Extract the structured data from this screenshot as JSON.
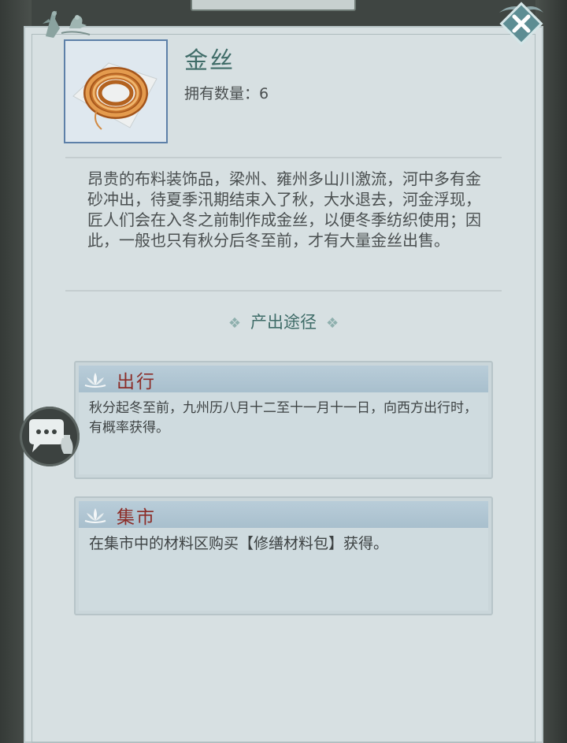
{
  "item": {
    "name": "金丝",
    "count_label": "拥有数量：6",
    "description": "昂贵的布料装饰品，梁州、雍州多山川激流，河中多有金砂冲出，待夏季汛期结束入了秋，大水退去，河金浮现，匠人们会在入冬之前制作成金丝，以便冬季纺织使用；因此，一般也只有秋分后冬至前，才有大量金丝出售。"
  },
  "source_section": {
    "title": "产出途径"
  },
  "sources": [
    {
      "title": "出行",
      "text": "秋分起冬至前，九州历八月十二至十一月十一日，向西方出行时，有概率获得。"
    },
    {
      "title": "集市",
      "text": "在集市中的材料区购买【修缮材料包】获得。"
    }
  ],
  "icons": {
    "close": "close-icon",
    "chat": "chat-bubble-icon",
    "lotus": "lotus-icon",
    "decoration": "birds-decoration-icon"
  },
  "colors": {
    "title_teal": "#3f6c68",
    "source_title_red": "#8c2d28",
    "item_frame_blue": "#5d80a8"
  }
}
